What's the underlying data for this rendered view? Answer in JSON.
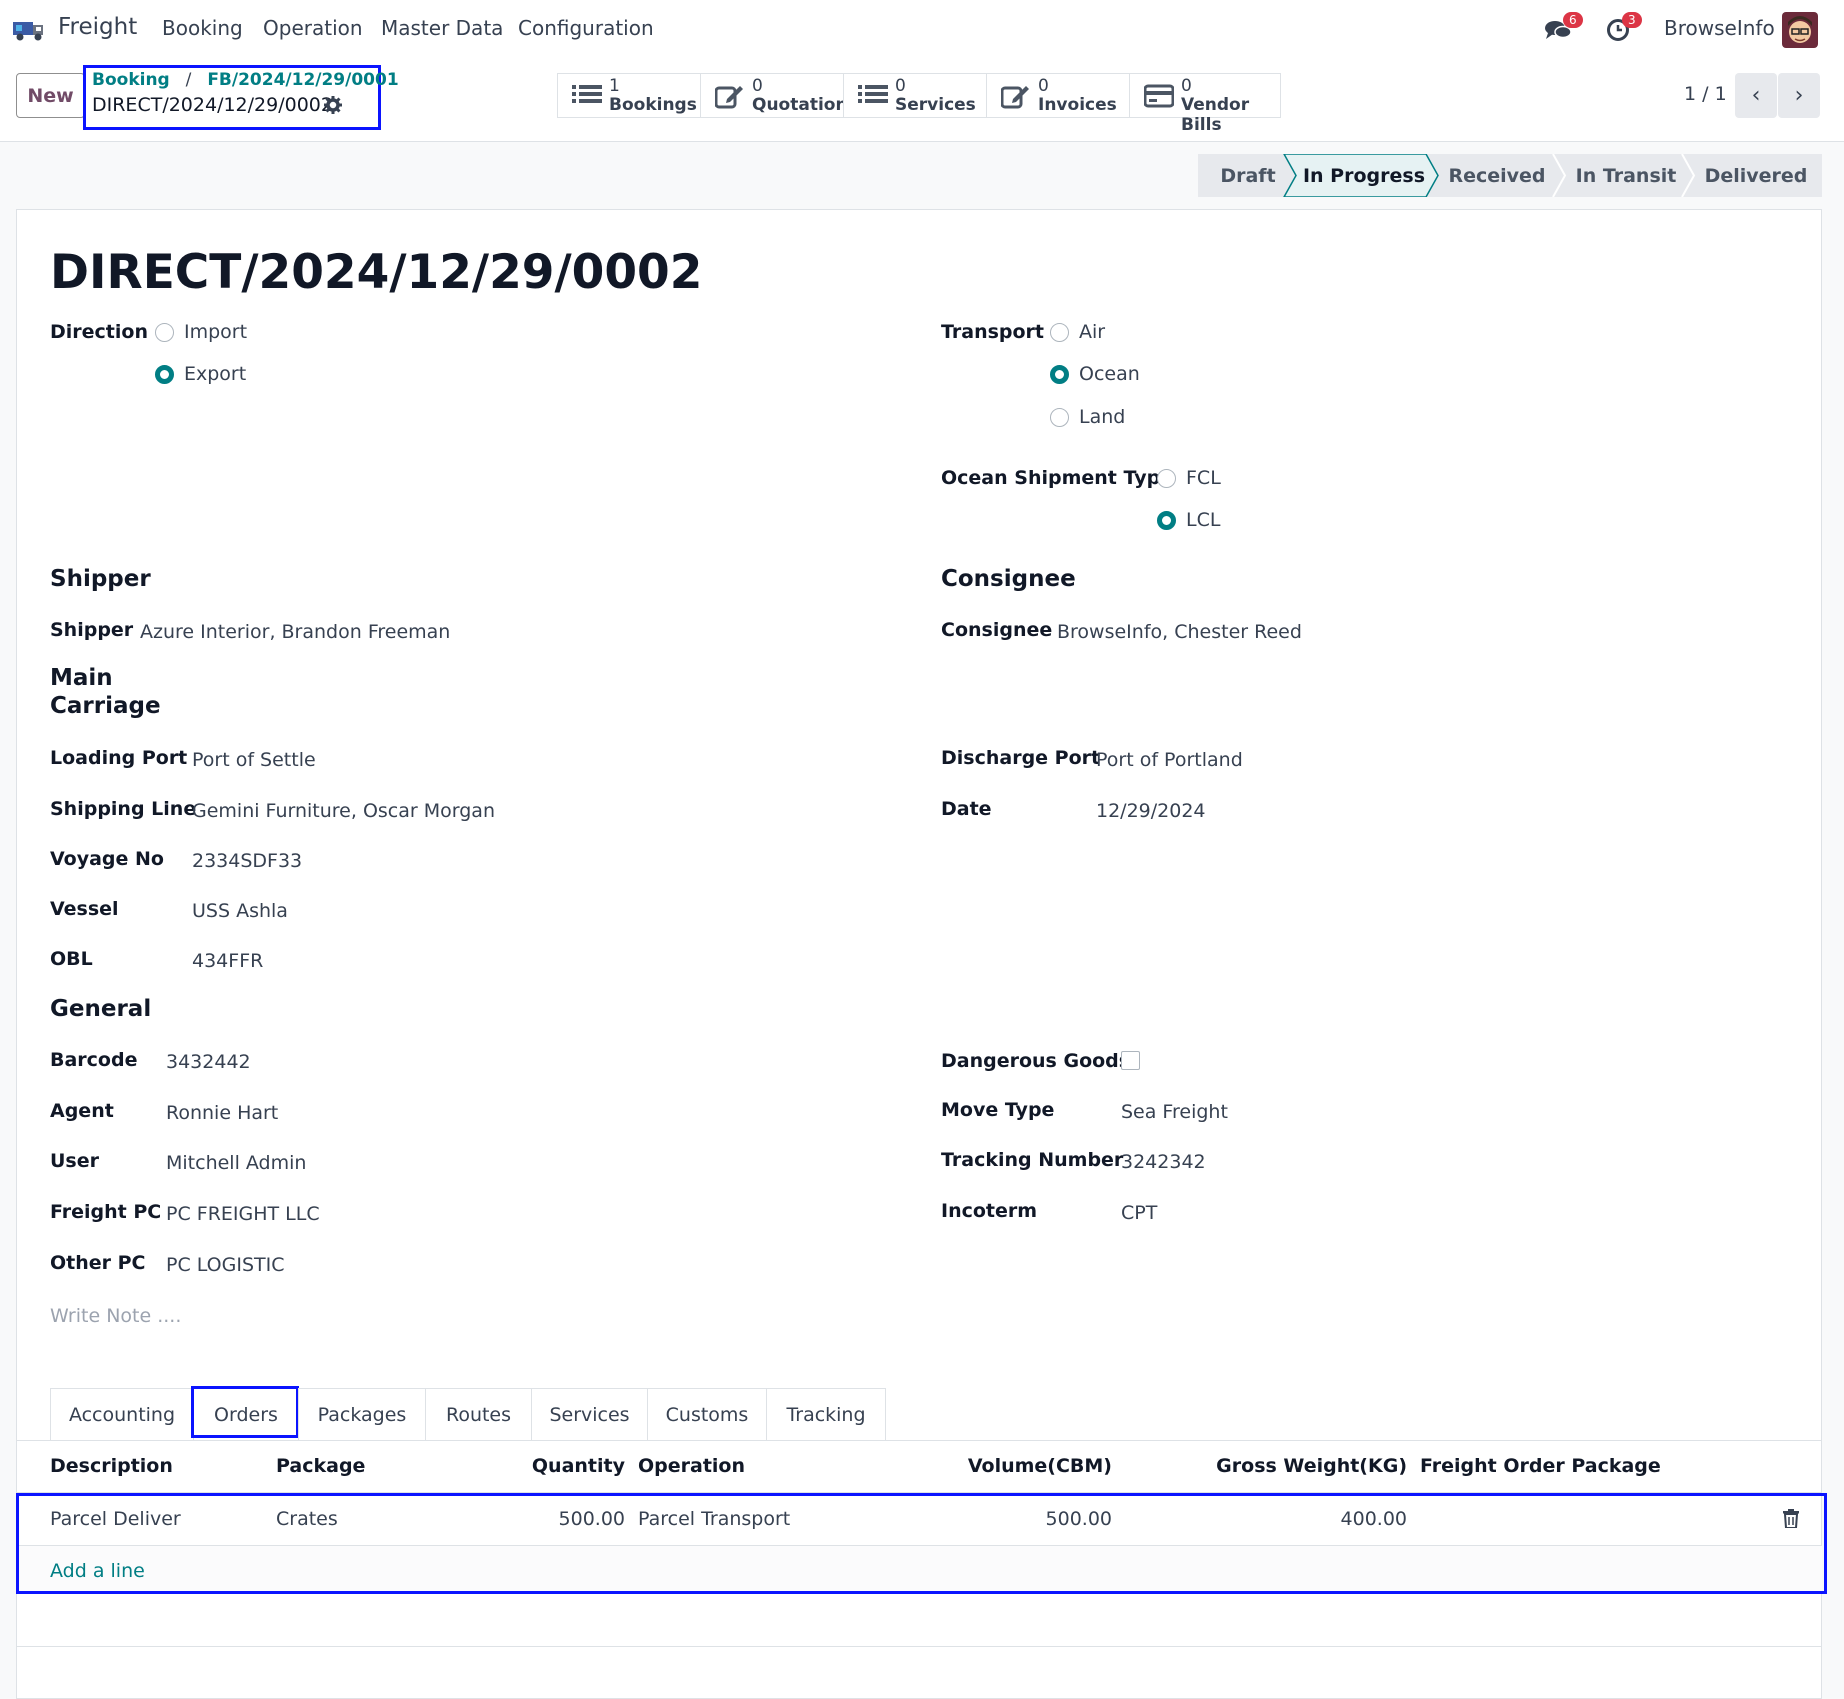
{
  "nav": {
    "brand": "Freight",
    "menus": [
      "Booking",
      "Operation",
      "Master Data",
      "Configuration"
    ],
    "messages_count": "6",
    "activities_count": "3",
    "company": "BrowseInfo"
  },
  "control_panel": {
    "new_label": "New",
    "breadcrumb_root": "Booking",
    "breadcrumb_sep": "/",
    "breadcrumb_parent": "FB/2024/12/29/0001",
    "breadcrumb_current": "DIRECT/2024/12/29/0002",
    "smart_buttons": [
      {
        "count": "1",
        "label": "Bookings",
        "icon": "list-icon"
      },
      {
        "count": "0",
        "label": "Quotation",
        "icon": "edit-icon"
      },
      {
        "count": "0",
        "label": "Services",
        "icon": "list-icon"
      },
      {
        "count": "0",
        "label": "Invoices",
        "icon": "edit-icon"
      },
      {
        "count": "0",
        "label": "Vendor Bills",
        "icon": "credit-card-icon"
      }
    ],
    "pager": "1 / 1"
  },
  "statusbar": {
    "stages": [
      "Draft",
      "In Progress",
      "Received",
      "In Transit",
      "Delivered"
    ],
    "active": "In Progress"
  },
  "form": {
    "title": "DIRECT/2024/12/29/0002",
    "direction_label": "Direction",
    "direction_options": [
      "Import",
      "Export"
    ],
    "direction_selected": "Export",
    "transport_label": "Transport",
    "transport_options": [
      "Air",
      "Ocean",
      "Land"
    ],
    "transport_selected": "Ocean",
    "ocean_type_label": "Ocean Shipment Type",
    "ocean_type_options": [
      "FCL",
      "LCL"
    ],
    "ocean_type_selected": "LCL",
    "shipper_section": "Shipper",
    "shipper_label": "Shipper",
    "shipper_value": "Azure Interior, Brandon Freeman",
    "consignee_section": "Consignee",
    "consignee_label": "Consignee",
    "consignee_value": "BrowseInfo, Chester Reed",
    "main_carriage_section_1": "Main",
    "main_carriage_section_2": "Carriage",
    "loading_port_label": "Loading Port",
    "loading_port_value": "Port of Settle",
    "shipping_line_label": "Shipping Line",
    "shipping_line_value": "Gemini Furniture, Oscar Morgan",
    "voyage_label": "Voyage No",
    "voyage_value": "2334SDF33",
    "vessel_label": "Vessel",
    "vessel_value": "USS Ashla",
    "obl_label": "OBL",
    "obl_value": "434FFR",
    "discharge_port_label": "Discharge Port",
    "discharge_port_value": "Port of Portland",
    "date_label": "Date",
    "date_value": "12/29/2024",
    "general_section": "General",
    "barcode_label": "Barcode",
    "barcode_value": "3432442",
    "agent_label": "Agent",
    "agent_value": "Ronnie Hart",
    "user_label": "User",
    "user_value": "Mitchell Admin",
    "freight_pc_label": "Freight PC",
    "freight_pc_value": "PC FREIGHT LLC",
    "other_pc_label": "Other PC",
    "other_pc_value": "PC LOGISTIC",
    "dangerous_goods_label": "Dangerous Goods",
    "dangerous_goods_checked": false,
    "move_type_label": "Move Type",
    "move_type_value": "Sea Freight",
    "tracking_label": "Tracking Number",
    "tracking_value": "3242342",
    "incoterm_label": "Incoterm",
    "incoterm_value": "CPT",
    "note_placeholder": "Write Note ...."
  },
  "tabs": {
    "items": [
      "Accounting",
      "Orders",
      "Packages",
      "Routes",
      "Services",
      "Customs",
      "Tracking"
    ],
    "active": "Orders"
  },
  "orders_table": {
    "columns": [
      "Description",
      "Package",
      "Quantity",
      "Operation",
      "Volume(CBM)",
      "Gross Weight(KG)",
      "Freight Order Package"
    ],
    "rows": [
      {
        "description": "Parcel Deliver",
        "package": "Crates",
        "quantity": "500.00",
        "operation": "Parcel Transport",
        "volume": "500.00",
        "gross_weight": "400.00",
        "freight_order_package": ""
      }
    ],
    "add_line": "Add a line"
  },
  "colors": {
    "accent": "#017e84",
    "brand": "#714b67",
    "highlight_box": "#0b14ff"
  }
}
